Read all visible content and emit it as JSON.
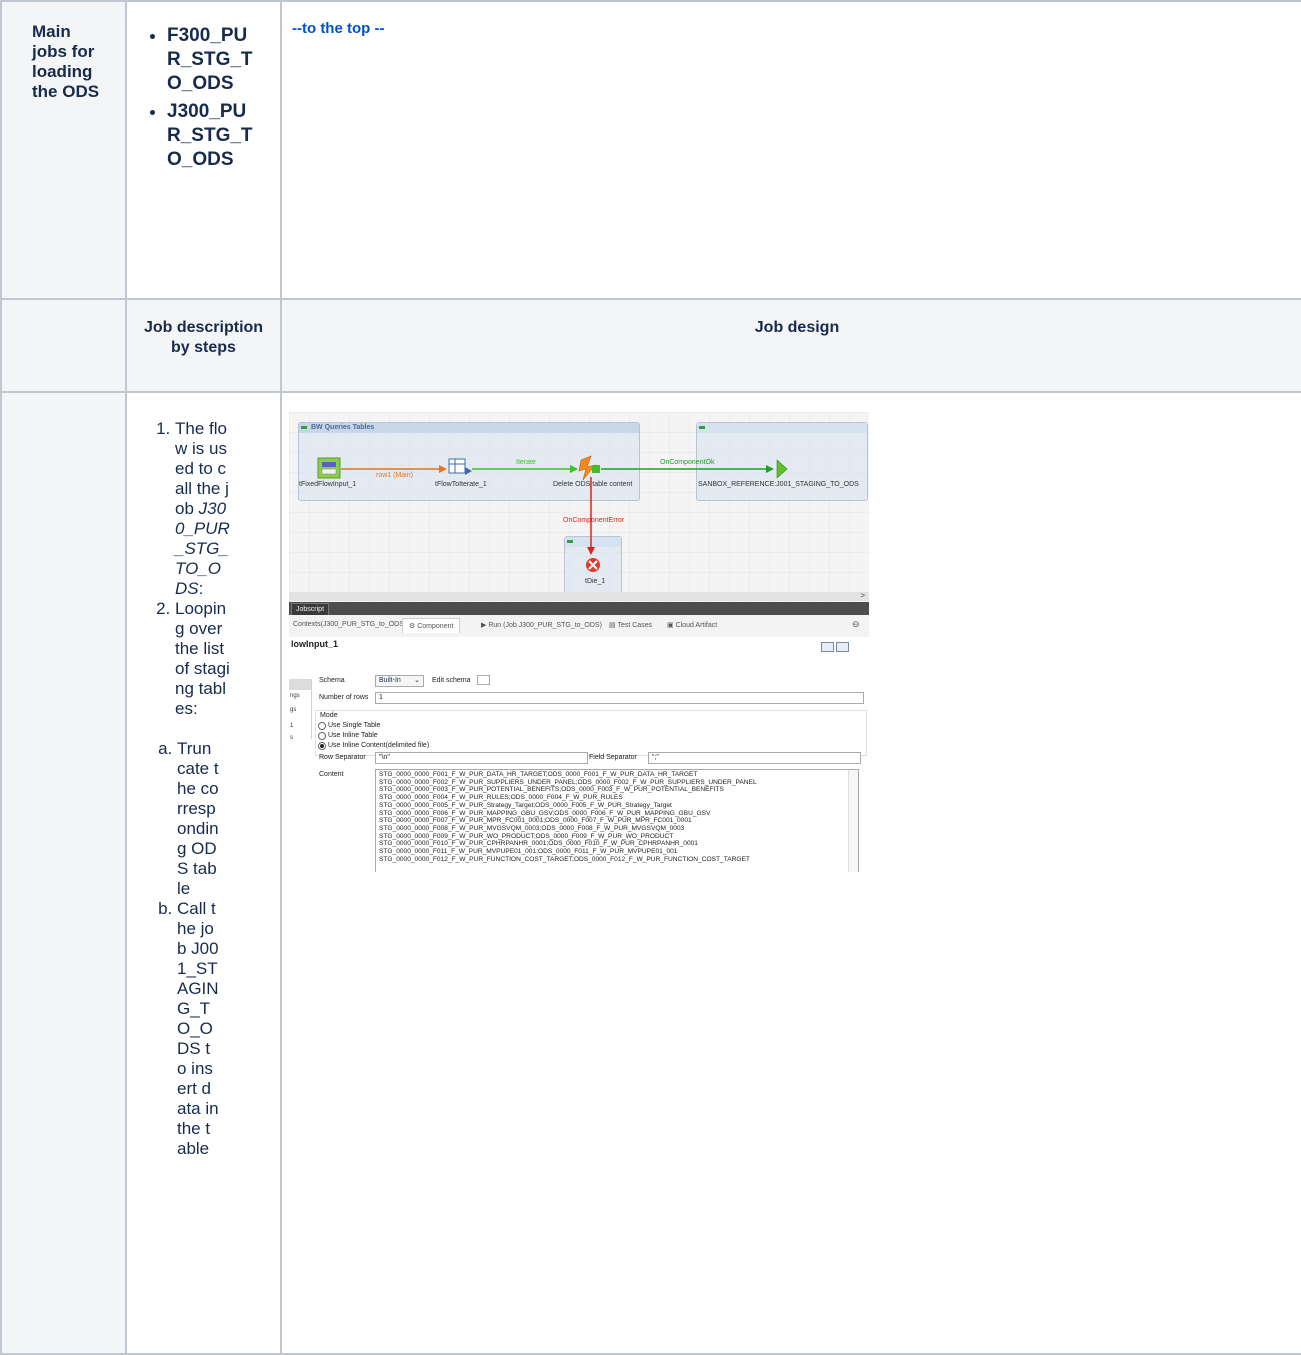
{
  "row1": {
    "title": "Main jobs for loading the ODS",
    "jobs": [
      "F300_PUR_STG_TO_ODS",
      "J300_PUR_STG_TO_ODS"
    ],
    "top_link": "--to the top --"
  },
  "row2": {
    "col2_header": "Job description by steps",
    "col3_header": "Job design"
  },
  "steps": {
    "step1_prefix": "The flow is used to call the job ",
    "step1_job": "J300_PUR_STG_TO_ODS",
    "step1_suffix": ":",
    "step2": "Looping over the list of staging tables:",
    "sub_a": "Truncate the corresponding ODS table",
    "sub_b": "Call the job J001_STAGING_TO_ODS to insert data in the table"
  },
  "screenshot": {
    "subjob_title": "BW Queries Tables",
    "components": {
      "fixed_input": "tFixedFlowInput_1",
      "flow_iterate": "tFlowToIterate_1",
      "delete_ods": "Delete ODS table content",
      "sanbox": "SANBOX_REFERENCE:J001_STAGING_TO_ODS",
      "tdie": "tDie_1"
    },
    "links": {
      "row_main": "row1 (Main)",
      "iterate": "Iterate",
      "on_ok": "OnComponentOk",
      "on_error": "OnComponentError"
    },
    "colors": {
      "main": "#e8731a",
      "iterate": "#3fbf2a",
      "ok": "#1f9e2a",
      "error": "#d9261c"
    },
    "jobscript_tab": "Jobscript",
    "view_tabs": [
      "Contexts(J300_PUR_STG_to_ODS)",
      "Component",
      "Run (Job J300_PUR_STG_to_ODS)",
      "Test Cases",
      "Cloud Artifact"
    ],
    "component_title": "lowInput_1",
    "sidebar_items": [
      "ngs",
      "gs",
      "1",
      "s"
    ],
    "schema_label": "Schema",
    "schema_value": "Built-In",
    "edit_schema_label": "Edit schema",
    "rows_label": "Number of rows",
    "rows_value": "1",
    "mode_label": "Mode",
    "mode_options": [
      "Use Single Table",
      "Use Inline Table",
      "Use Inline Content(delimited file)"
    ],
    "row_sep_label": "Row Separator",
    "row_sep_value": "\"\\n\"",
    "field_sep_label": "Field Separator",
    "field_sep_value": "\";\"",
    "content_label": "Content",
    "content_lines": [
      "STG_0000_0000_F001_F_W_PUR_DATA_HR_TARGET;ODS_0000_F001_F_W_PUR_DATA_HR_TARGET",
      "STG_0000_0000_F002_F_W_PUR_SUPPLIERS_UNDER_PANEL;ODS_0000_F002_F_W_PUR_SUPPLIERS_UNDER_PANEL",
      "STG_0000_0000_F003_F_W_PUR_POTENTIAL_BENEFITS;ODS_0000_F003_F_W_PUR_POTENTIAL_BENEFITS",
      "STG_0000_0000_F004_F_W_PUR_RULES;ODS_0000_F004_F_W_PUR_RULES",
      "STG_0000_0000_F005_F_W_PUR_Strategy_Target;ODS_0000_F005_F_W_PUR_Strategy_Target",
      "STG_0000_0000_F006_F_W_PUR_MAPPING_GBU_GSV;ODS_0000_F006_F_W_PUR_MAPPING_GBU_GSV",
      "STG_0000_0000_F007_F_W_PUR_MPR_FC001_0001;ODS_0000_F007_F_W_PUR_MPR_FC001_0001",
      "STG_0000_0000_F008_F_W_PUR_MVGSVQM_0003;ODS_0000_F008_F_W_PUR_MVGSVQM_0003",
      "STG_0000_0000_F009_F_W_PUR_WO_PRODUCT;ODS_0000_F009_F_W_PUR_WO_PRODUCT",
      "STG_0000_0000_F010_F_W_PUR_CPHRPANHR_0001;ODS_0000_F010_F_W_PUR_CPHRPANHR_0001",
      "STG_0000_0000_F011_F_W_PUR_MVPUPE01_001;ODS_0000_F011_F_W_PUR_MVPUPE01_001",
      "STG_0000_0000_F012_F_W_PUR_FUNCTION_COST_TARGET;ODS_0000_F012_F_W_PUR_FUNCTION_COST_TARGET"
    ]
  }
}
